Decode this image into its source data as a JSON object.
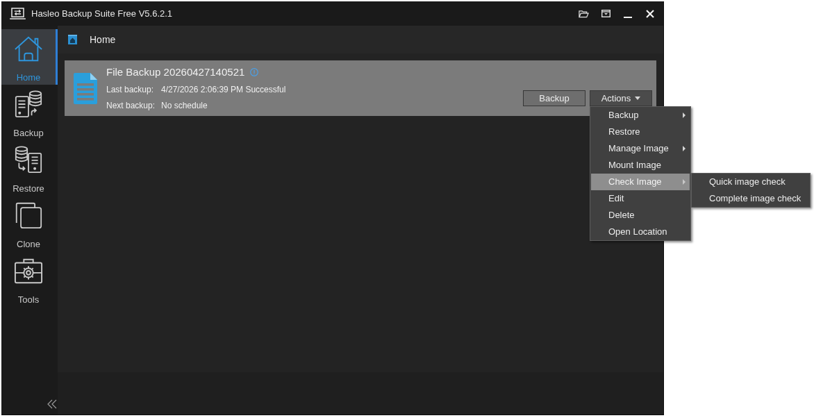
{
  "window": {
    "title": "Hasleo Backup Suite Free V5.6.2.1"
  },
  "sidebar": {
    "items": [
      {
        "label": "Home",
        "selected": true
      },
      {
        "label": "Backup",
        "selected": false
      },
      {
        "label": "Restore",
        "selected": false
      },
      {
        "label": "Clone",
        "selected": false
      },
      {
        "label": "Tools",
        "selected": false
      }
    ]
  },
  "header": {
    "title": "Home"
  },
  "backup_card": {
    "title": "File Backup 20260427140521",
    "fields": [
      {
        "label": "Last backup:",
        "value": "4/27/2026 2:06:39 PM Successful"
      },
      {
        "label": "Next backup:",
        "value": "No schedule"
      }
    ],
    "buttons": [
      {
        "label": "Backup",
        "has_dropdown": false
      },
      {
        "label": "Actions",
        "has_dropdown": true,
        "menu": {
          "items": [
            {
              "label": "Backup",
              "has_submenu": true,
              "selected": false
            },
            {
              "label": "Restore",
              "has_submenu": false,
              "selected": false
            },
            {
              "label": "Manage Image",
              "has_submenu": true,
              "selected": false
            },
            {
              "label": "Mount Image",
              "has_submenu": false,
              "selected": false
            },
            {
              "label": "Check Image",
              "has_submenu": true,
              "selected": true,
              "submenu": [
                {
                  "label": "Quick image check",
                  "selected": false
                },
                {
                  "label": "Complete image check",
                  "selected": false
                }
              ]
            },
            {
              "label": "Edit",
              "has_submenu": false,
              "selected": false
            },
            {
              "label": "Delete",
              "has_submenu": false,
              "selected": false
            },
            {
              "label": "Open Location",
              "has_submenu": false,
              "selected": false
            }
          ]
        }
      }
    ]
  }
}
